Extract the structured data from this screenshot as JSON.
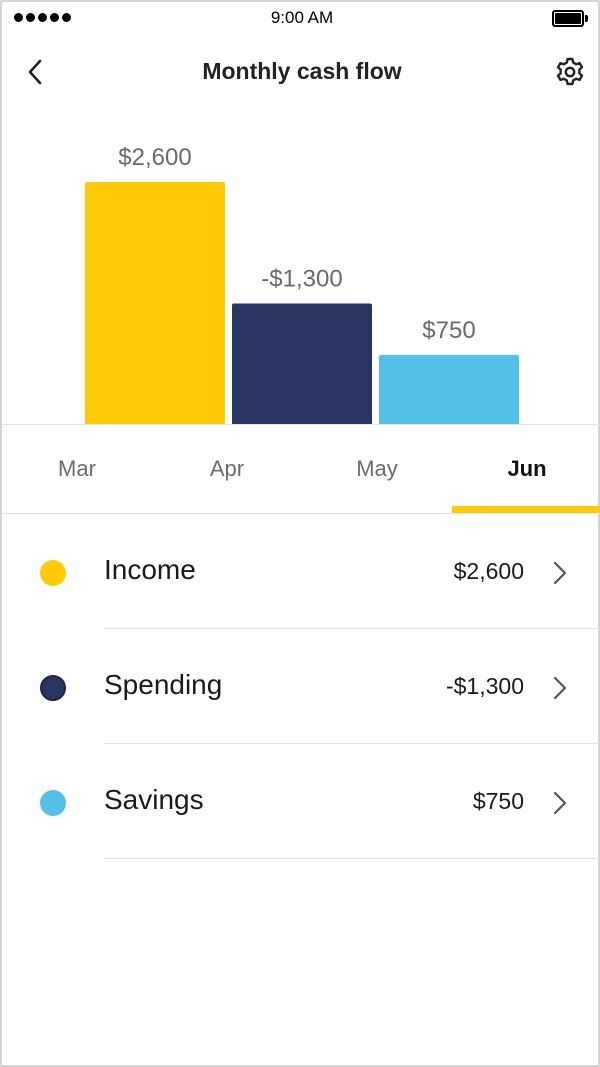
{
  "status_bar": {
    "time": "9:00 AM",
    "signal_icon": "signal-dots-icon",
    "battery_icon": "battery-full-icon"
  },
  "header": {
    "title": "Monthly cash flow",
    "back_icon": "chevron-left-icon",
    "settings_icon": "gear-icon"
  },
  "colors": {
    "income": "#FFCB05",
    "spending": "#2B3564",
    "savings": "#53C1E7",
    "active_tab_indicator": "#FFCB05"
  },
  "chart_data": {
    "type": "bar",
    "categories": [
      "Income",
      "Spending",
      "Savings"
    ],
    "values": [
      2600,
      -1300,
      750
    ],
    "value_labels": [
      "$2,600",
      "-$1,300",
      "$750"
    ],
    "colors": [
      "#FFCB05",
      "#2B3564",
      "#53C1E7"
    ],
    "title": "",
    "xlabel": "",
    "ylabel": "",
    "grid": false
  },
  "tabs": [
    {
      "label": "Mar",
      "active": false
    },
    {
      "label": "Apr",
      "active": false
    },
    {
      "label": "May",
      "active": false
    },
    {
      "label": "Jun",
      "active": true
    }
  ],
  "list": [
    {
      "label": "Income",
      "amount": "$2,600",
      "color": "#FFCB05",
      "chevron_icon": "chevron-right-icon"
    },
    {
      "label": "Spending",
      "amount": "-$1,300",
      "color": "#2B3564",
      "chevron_icon": "chevron-right-icon"
    },
    {
      "label": "Savings",
      "amount": "$750",
      "color": "#53C1E7",
      "chevron_icon": "chevron-right-icon"
    }
  ]
}
